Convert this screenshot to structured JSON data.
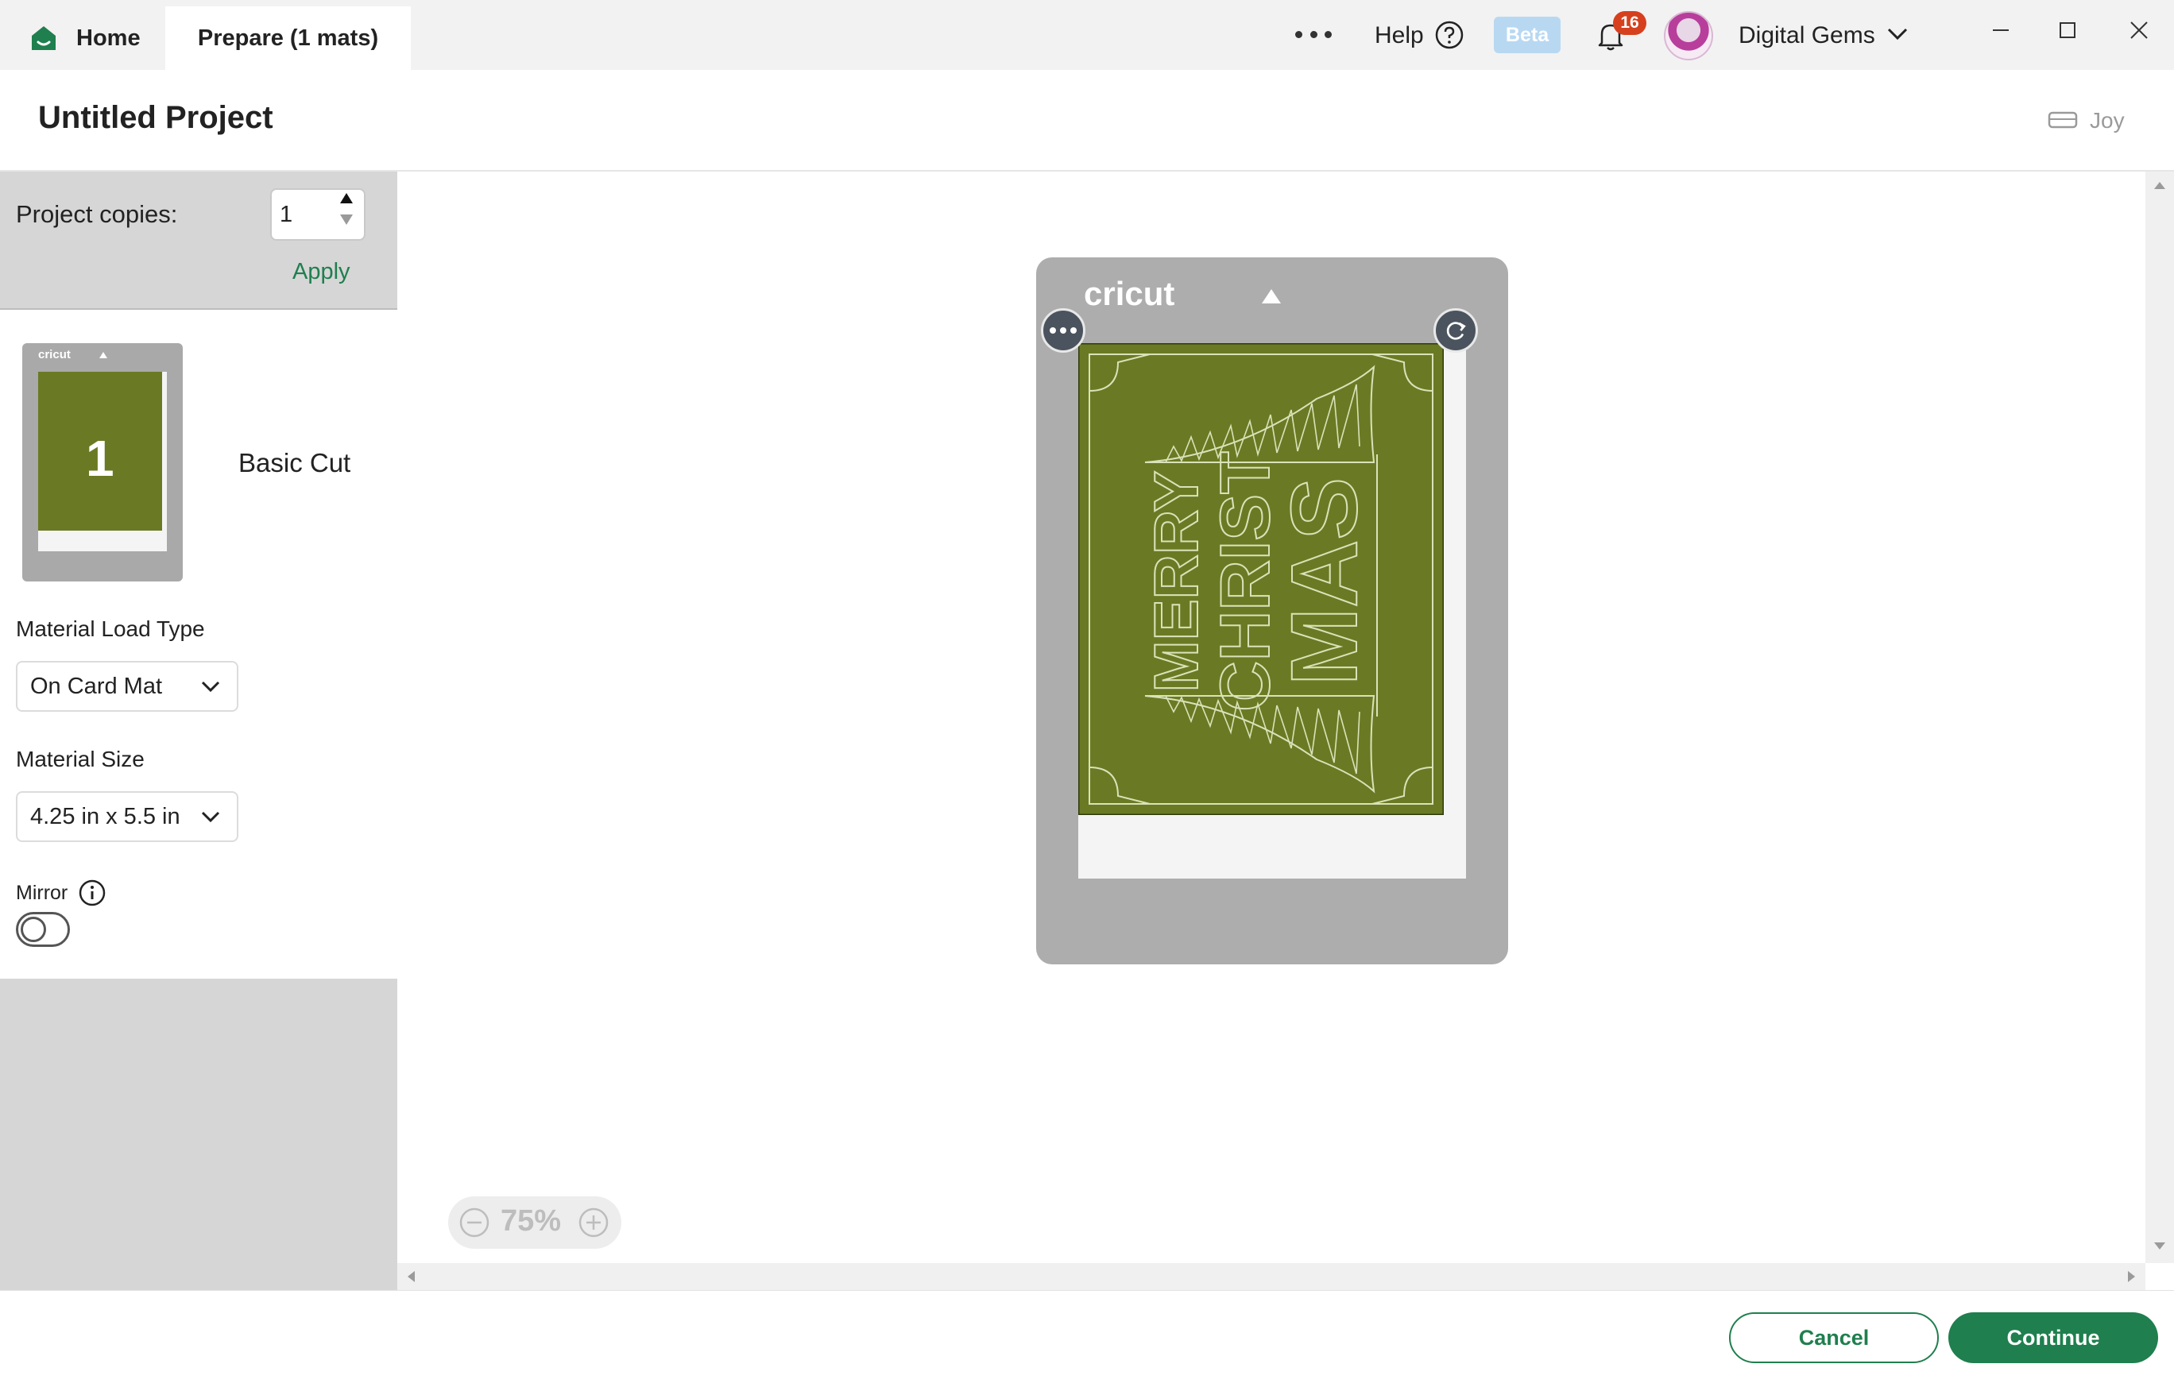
{
  "topbar": {
    "home_label": "Home",
    "prepare_tab_label": "Prepare (1 mats)",
    "help_label": "Help",
    "beta_label": "Beta",
    "notification_count": "16",
    "user_name": "Digital Gems"
  },
  "header": {
    "title": "Untitled Project",
    "machine_name": "Joy"
  },
  "left_panel": {
    "copies_label": "Project copies:",
    "copies_value": "1",
    "apply_label": "Apply",
    "mat_brand": "cricut",
    "mat_number": "1",
    "cut_type": "Basic Cut",
    "load_type_label": "Material Load Type",
    "load_type_value": "On Card Mat",
    "size_label": "Material Size",
    "size_value": "4.25 in x 5.5 in",
    "mirror_label": "Mirror",
    "mirror_on": false
  },
  "canvas": {
    "mat_brand": "cricut",
    "design_color": "#6a7a24",
    "design_text": "MERRY CHRISTMAS",
    "zoom_level": "75%"
  },
  "footer": {
    "cancel_label": "Cancel",
    "continue_label": "Continue"
  },
  "colors": {
    "accent_green": "#1f7f4e",
    "notification_red": "#d6401e",
    "beta_blue": "#b8d8f2",
    "mat_gray": "#adadad"
  },
  "icons": [
    "home-icon",
    "more-icon",
    "help-icon",
    "bell-icon",
    "chevron-down-icon",
    "minimize-icon",
    "maximize-icon",
    "close-icon",
    "machine-icon",
    "info-icon",
    "rotate-icon",
    "zoom-out-icon",
    "zoom-in-icon"
  ]
}
